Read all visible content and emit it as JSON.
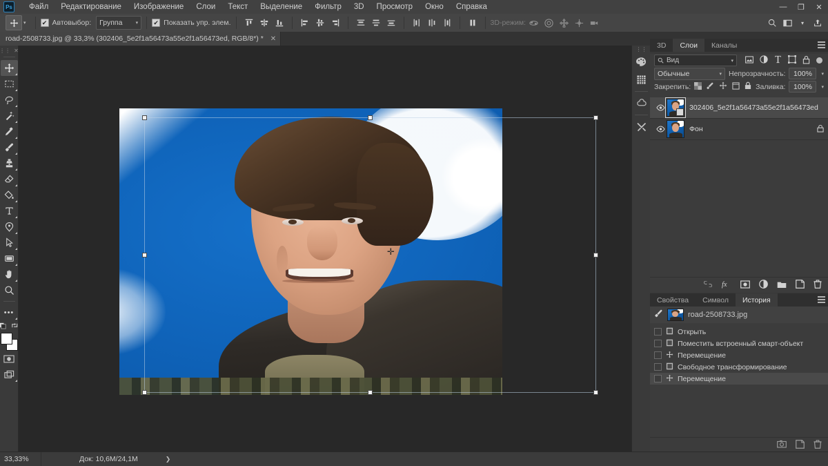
{
  "app": {
    "name": "Adobe Photoshop",
    "logo_text": "Ps"
  },
  "menubar": {
    "items": [
      {
        "label": "Файл"
      },
      {
        "label": "Редактирование"
      },
      {
        "label": "Изображение"
      },
      {
        "label": "Слои"
      },
      {
        "label": "Текст"
      },
      {
        "label": "Выделение"
      },
      {
        "label": "Фильтр"
      },
      {
        "label": "3D"
      },
      {
        "label": "Просмотр"
      },
      {
        "label": "Окно"
      },
      {
        "label": "Справка"
      }
    ],
    "window_controls": {
      "minimize": "—",
      "restore": "❐",
      "close": "✕"
    }
  },
  "options_bar": {
    "tool_icon": "move-tool-icon",
    "autoselect_label": "Автовыбор:",
    "autoselect_checked": "✔",
    "autoselect_value": "Группа",
    "show_controls_label": "Показать упр. элем.",
    "show_controls_checked": "✔",
    "three_d_label": "3D-режим:",
    "align_icons": [
      "align-top-icon",
      "align-vcenter-icon",
      "align-bottom-icon",
      "align-left-icon",
      "align-hcenter-icon",
      "align-right-icon"
    ],
    "distribute_icons": [
      "distribute-top-icon",
      "distribute-vcenter-icon",
      "distribute-bottom-icon",
      "distribute-left-icon",
      "distribute-hcenter-icon",
      "distribute-right-icon"
    ],
    "more_icon": "align-more-icon",
    "three_d_icons": [
      "3d-orbit-icon",
      "3d-roll-icon",
      "3d-pan-icon",
      "3d-slide-icon",
      "3d-camera-icon"
    ],
    "right_icons": [
      "search-icon",
      "workspace-icon",
      "chevron-down-icon",
      "share-icon"
    ]
  },
  "document_tab": {
    "title": "road-2508733.jpg @ 33,3% (302406_5e2f1a56473a55e2f1a56473ed, RGB/8*) *",
    "close": "✕"
  },
  "toolbar": {
    "tools": [
      {
        "name": "move-tool",
        "icon": "move-icon",
        "active": true,
        "has_submenu": true
      },
      {
        "name": "rectangular-marquee-tool",
        "icon": "marquee-icon",
        "active": false,
        "has_submenu": true
      },
      {
        "name": "lasso-tool",
        "icon": "lasso-icon",
        "active": false,
        "has_submenu": true
      },
      {
        "name": "magic-wand-tool",
        "icon": "magic-wand-icon",
        "active": false,
        "has_submenu": true
      },
      {
        "name": "eyedropper-tool",
        "icon": "eyedropper-icon",
        "active": false,
        "has_submenu": true
      },
      {
        "name": "brush-tool",
        "icon": "brush-icon",
        "active": false,
        "has_submenu": true
      },
      {
        "name": "clone-stamp-tool",
        "icon": "clone-stamp-icon",
        "active": false,
        "has_submenu": true
      },
      {
        "name": "eraser-tool",
        "icon": "eraser-icon",
        "active": false,
        "has_submenu": true
      },
      {
        "name": "gradient-tool",
        "icon": "paint-bucket-icon",
        "active": false,
        "has_submenu": true
      },
      {
        "name": "type-tool",
        "icon": "text-icon",
        "active": false,
        "has_submenu": true
      },
      {
        "name": "pen-tool",
        "icon": "pen-icon",
        "active": false,
        "has_submenu": true
      },
      {
        "name": "path-selection-tool",
        "icon": "path-arrow-icon",
        "active": false,
        "has_submenu": true
      },
      {
        "name": "rectangle-tool",
        "icon": "rectangle-icon",
        "active": false,
        "has_submenu": true
      },
      {
        "name": "hand-tool",
        "icon": "hand-icon",
        "active": false,
        "has_submenu": true
      },
      {
        "name": "zoom-tool",
        "icon": "zoom-icon",
        "active": false,
        "has_submenu": false
      }
    ],
    "edit_toolbar_icon": "ellipsis-icon",
    "default_colors_icon": "default-colors-icon",
    "swap_colors_icon": "swap-colors-icon",
    "foreground_color": "#ffffff",
    "background_color": "#ffffff",
    "quick_mask_icon": "quick-mask-icon",
    "screen_mode_icon": "screen-mode-icon"
  },
  "dock_rail": {
    "items": [
      {
        "name": "color-palette-icon"
      },
      {
        "name": "swatches-grid-icon"
      },
      {
        "name": "creative-cloud-icon"
      },
      {
        "name": "tools-icon"
      }
    ]
  },
  "layers_panel": {
    "tabs": [
      {
        "label": "3D",
        "active": false
      },
      {
        "label": "Слои",
        "active": true
      },
      {
        "label": "Каналы",
        "active": false
      }
    ],
    "filter_placeholder": "Вид",
    "filter_icons": [
      "image-filter-icon",
      "adjustment-filter-icon",
      "type-filter-icon",
      "shape-filter-icon",
      "smart-filter-icon"
    ],
    "blend_mode": "Обычные",
    "opacity_label": "Непрозрачность:",
    "opacity_value": "100%",
    "lock_label": "Закрепить:",
    "lock_icons": [
      "lock-transparent-icon",
      "lock-image-icon",
      "lock-position-icon",
      "lock-artboard-icon",
      "lock-all-icon"
    ],
    "fill_label": "Заливка:",
    "fill_value": "100%",
    "layers": [
      {
        "name": "302406_5e2f1a56473a55e2f1a56473ed",
        "visible": true,
        "selected": true,
        "smart_object": true,
        "locked": false
      },
      {
        "name": "Фон",
        "visible": true,
        "selected": false,
        "smart_object": false,
        "locked": true
      }
    ],
    "footer_icons": [
      "link-layers-icon",
      "layer-style-fx-icon",
      "add-mask-icon",
      "adjustment-layer-icon",
      "new-group-icon",
      "new-layer-icon",
      "delete-layer-icon"
    ]
  },
  "history_panel": {
    "tabs": [
      {
        "label": "Свойства",
        "active": false
      },
      {
        "label": "Символ",
        "active": false
      },
      {
        "label": "История",
        "active": true
      }
    ],
    "snapshot": {
      "name": "road-2508733.jpg",
      "icon": "snapshot-brush-icon"
    },
    "states": [
      {
        "label": "Открыть",
        "icon": "document-icon",
        "current": false
      },
      {
        "label": "Поместить встроенный смарт-объект",
        "icon": "document-icon",
        "current": false
      },
      {
        "label": "Перемещение",
        "icon": "move-icon",
        "current": false
      },
      {
        "label": "Свободное трансформирование",
        "icon": "document-icon",
        "current": false
      },
      {
        "label": "Перемещение",
        "icon": "move-icon",
        "current": true
      }
    ],
    "footer_icons": [
      "snapshot-icon",
      "new-document-icon",
      "delete-icon"
    ]
  },
  "status_bar": {
    "zoom": "33,33%",
    "doc_info": "Док: 10,6M/24,1M",
    "expand_arrow": "❯"
  },
  "canvas": {
    "image_alt": "portrait-photo",
    "transform_handles": 8,
    "crosshair": "✛"
  },
  "colors": {
    "accent": "#3ba3e0",
    "panel_bg": "#3c3c3c",
    "canvas_bg": "#282828",
    "photo_blue": "#0f63b9"
  }
}
